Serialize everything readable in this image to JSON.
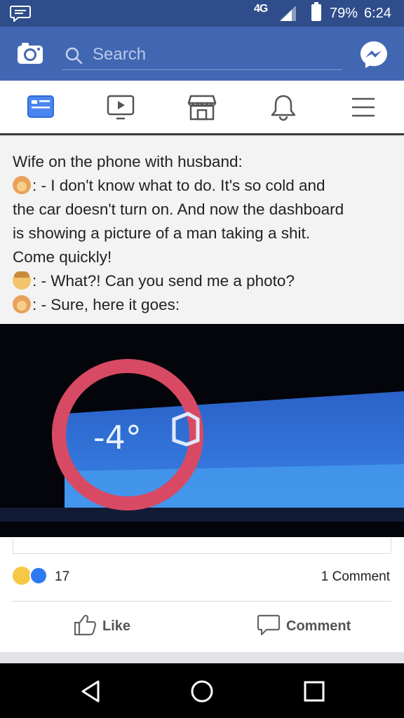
{
  "status_bar": {
    "network": "4G",
    "battery_pct": "79%",
    "time": "6:24",
    "icons": [
      "chat-notification-icon",
      "signal-icon",
      "battery-icon"
    ]
  },
  "top_bar": {
    "search_placeholder": "Search",
    "icons": [
      "camera-icon",
      "search-icon",
      "messenger-icon"
    ],
    "bg_color": "#4267b2"
  },
  "nav_tabs": [
    {
      "name": "news-feed",
      "icon": "news-feed-icon",
      "active": true
    },
    {
      "name": "watch",
      "icon": "video-icon",
      "active": false
    },
    {
      "name": "marketplace",
      "icon": "marketplace-icon",
      "active": false
    },
    {
      "name": "notifications",
      "icon": "bell-icon",
      "active": false
    },
    {
      "name": "menu",
      "icon": "menu-icon",
      "active": false
    }
  ],
  "post": {
    "meme_lines": [
      {
        "prefix": "",
        "text": "Wife on the phone with husband:"
      },
      {
        "prefix": "wife",
        "text": ": - I don't know what to do. It's so cold and"
      },
      {
        "prefix": "",
        "text": "the car doesn't turn on. And now the dashboard"
      },
      {
        "prefix": "",
        "text": "is showing a picture of a man taking a shit."
      },
      {
        "prefix": "",
        "text": "Come quickly!"
      },
      {
        "prefix": "husband",
        "text": ": - What?! Can you send me a photo?"
      },
      {
        "prefix": "wife",
        "text": ": - Sure, here it goes:"
      }
    ],
    "dashboard_reading": "-4°",
    "reaction_count": "17",
    "comment_count": "1 Comment",
    "actions": {
      "like": "Like",
      "comment": "Comment"
    },
    "colors": {
      "highlight_circle": "#e0405a",
      "dashboard_blue": "#2e6fd8",
      "like_blue": "#2d79f3"
    }
  },
  "system_nav": [
    "back-icon",
    "home-icon",
    "recents-icon"
  ]
}
